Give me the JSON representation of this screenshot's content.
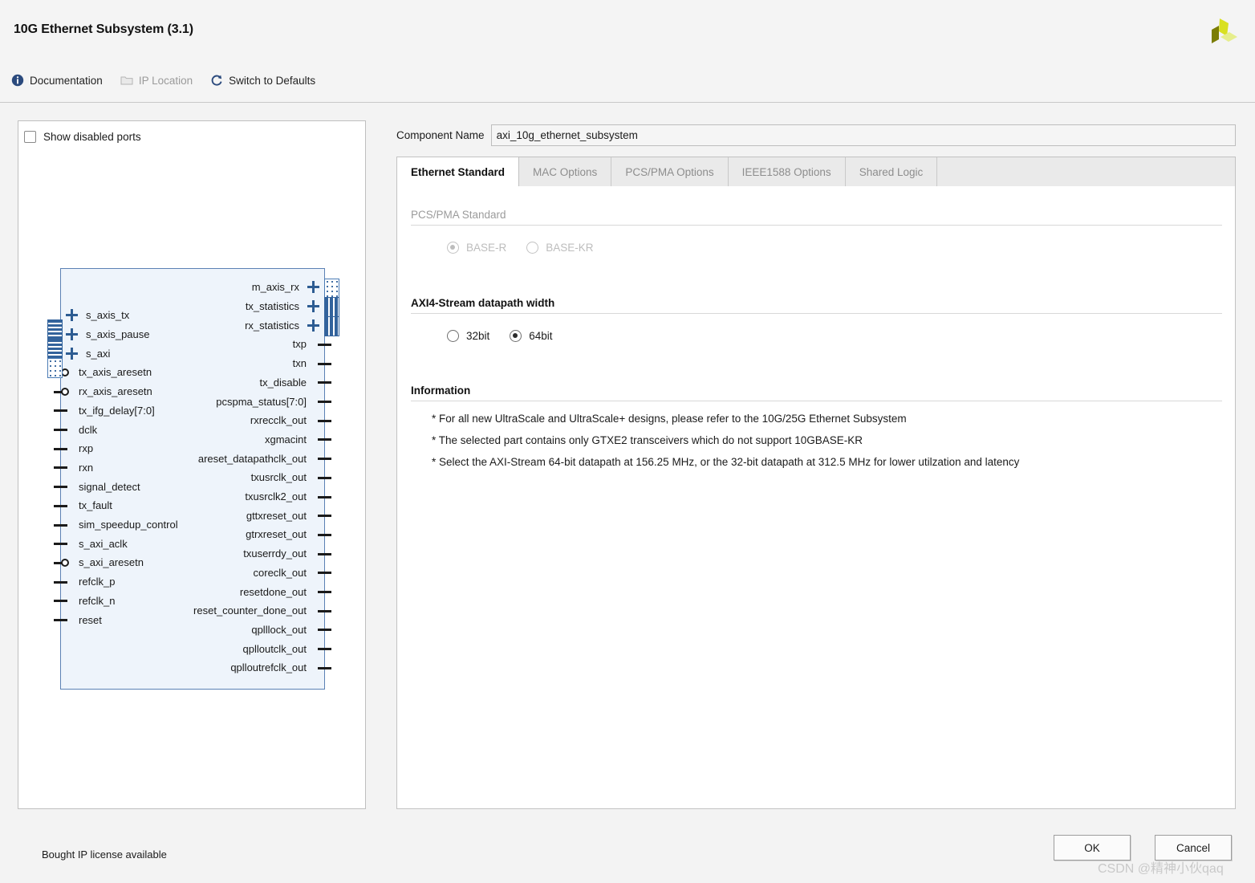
{
  "window": {
    "title": "10G Ethernet Subsystem (3.1)",
    "logo_colors": {
      "dark": "#7b7d05",
      "bright": "#d9e021",
      "pale": "#e6ee8c"
    }
  },
  "toolbar": {
    "items": [
      {
        "label": "Documentation",
        "icon": "info-icon",
        "enabled": true
      },
      {
        "label": "IP Location",
        "icon": "folder-icon",
        "enabled": false
      },
      {
        "label": "Switch to Defaults",
        "icon": "refresh-icon",
        "enabled": true
      }
    ]
  },
  "left_panel": {
    "show_disabled_ports": {
      "label": "Show disabled ports",
      "checked": false
    },
    "ip_block": {
      "left_ports": [
        {
          "name": "s_axis_tx",
          "pin": "bus-plus"
        },
        {
          "name": "s_axis_pause",
          "pin": "bus-plus"
        },
        {
          "name": "s_axi",
          "pin": "bus-plus"
        },
        {
          "name": "tx_axis_aresetn",
          "pin": "bubble"
        },
        {
          "name": "rx_axis_aresetn",
          "pin": "bubble"
        },
        {
          "name": "tx_ifg_delay[7:0]",
          "pin": "line"
        },
        {
          "name": "dclk",
          "pin": "line"
        },
        {
          "name": "rxp",
          "pin": "line"
        },
        {
          "name": "rxn",
          "pin": "line"
        },
        {
          "name": "signal_detect",
          "pin": "line"
        },
        {
          "name": "tx_fault",
          "pin": "line"
        },
        {
          "name": "sim_speedup_control",
          "pin": "line"
        },
        {
          "name": "s_axi_aclk",
          "pin": "line"
        },
        {
          "name": "s_axi_aresetn",
          "pin": "bubble"
        },
        {
          "name": "refclk_p",
          "pin": "line"
        },
        {
          "name": "refclk_n",
          "pin": "line"
        },
        {
          "name": "reset",
          "pin": "line"
        }
      ],
      "right_ports": [
        {
          "name": "m_axis_rx",
          "pin": "bus-plus"
        },
        {
          "name": "tx_statistics",
          "pin": "bus-plus"
        },
        {
          "name": "rx_statistics",
          "pin": "bus-plus"
        },
        {
          "name": "txp",
          "pin": "line"
        },
        {
          "name": "txn",
          "pin": "line"
        },
        {
          "name": "tx_disable",
          "pin": "line"
        },
        {
          "name": "pcspma_status[7:0]",
          "pin": "line"
        },
        {
          "name": "rxrecclk_out",
          "pin": "line"
        },
        {
          "name": "xgmacint",
          "pin": "line"
        },
        {
          "name": "areset_datapathclk_out",
          "pin": "line"
        },
        {
          "name": "txusrclk_out",
          "pin": "line"
        },
        {
          "name": "txusrclk2_out",
          "pin": "line"
        },
        {
          "name": "gttxreset_out",
          "pin": "line"
        },
        {
          "name": "gtrxreset_out",
          "pin": "line"
        },
        {
          "name": "txuserrdy_out",
          "pin": "line"
        },
        {
          "name": "coreclk_out",
          "pin": "line"
        },
        {
          "name": "resetdone_out",
          "pin": "line"
        },
        {
          "name": "reset_counter_done_out",
          "pin": "line"
        },
        {
          "name": "qplllock_out",
          "pin": "line"
        },
        {
          "name": "qplloutclk_out",
          "pin": "line"
        },
        {
          "name": "qplloutrefclk_out",
          "pin": "line"
        }
      ]
    }
  },
  "right_panel": {
    "component_name": {
      "label": "Component Name",
      "value": "axi_10g_ethernet_subsystem"
    },
    "tabs": [
      {
        "label": "Ethernet Standard",
        "active": true
      },
      {
        "label": "MAC Options",
        "active": false
      },
      {
        "label": "PCS/PMA Options",
        "active": false
      },
      {
        "label": "IEEE1588 Options",
        "active": false
      },
      {
        "label": "Shared Logic",
        "active": false
      }
    ],
    "pcs_pma_standard": {
      "title": "PCS/PMA Standard",
      "enabled": false,
      "options": [
        {
          "label": "BASE-R",
          "selected": true
        },
        {
          "label": "BASE-KR",
          "selected": false
        }
      ]
    },
    "datapath_width": {
      "title": "AXI4-Stream datapath width",
      "enabled": true,
      "options": [
        {
          "label": "32bit",
          "selected": false
        },
        {
          "label": "64bit",
          "selected": true
        }
      ]
    },
    "information": {
      "title": "Information",
      "lines": [
        "* For all new UltraScale and UltraScale+ designs, please refer to the 10G/25G Ethernet Subsystem",
        "* The selected part contains only GTXE2 transceivers which do not support 10GBASE-KR",
        "* Select the AXI-Stream 64-bit datapath at 156.25 MHz, or the 32-bit datapath at 312.5 MHz for lower utilzation and latency"
      ]
    }
  },
  "footer": {
    "license_status": "Bought IP license available",
    "ok_label": "OK",
    "cancel_label": "Cancel"
  },
  "watermark": "CSDN @精神小伙qaq"
}
